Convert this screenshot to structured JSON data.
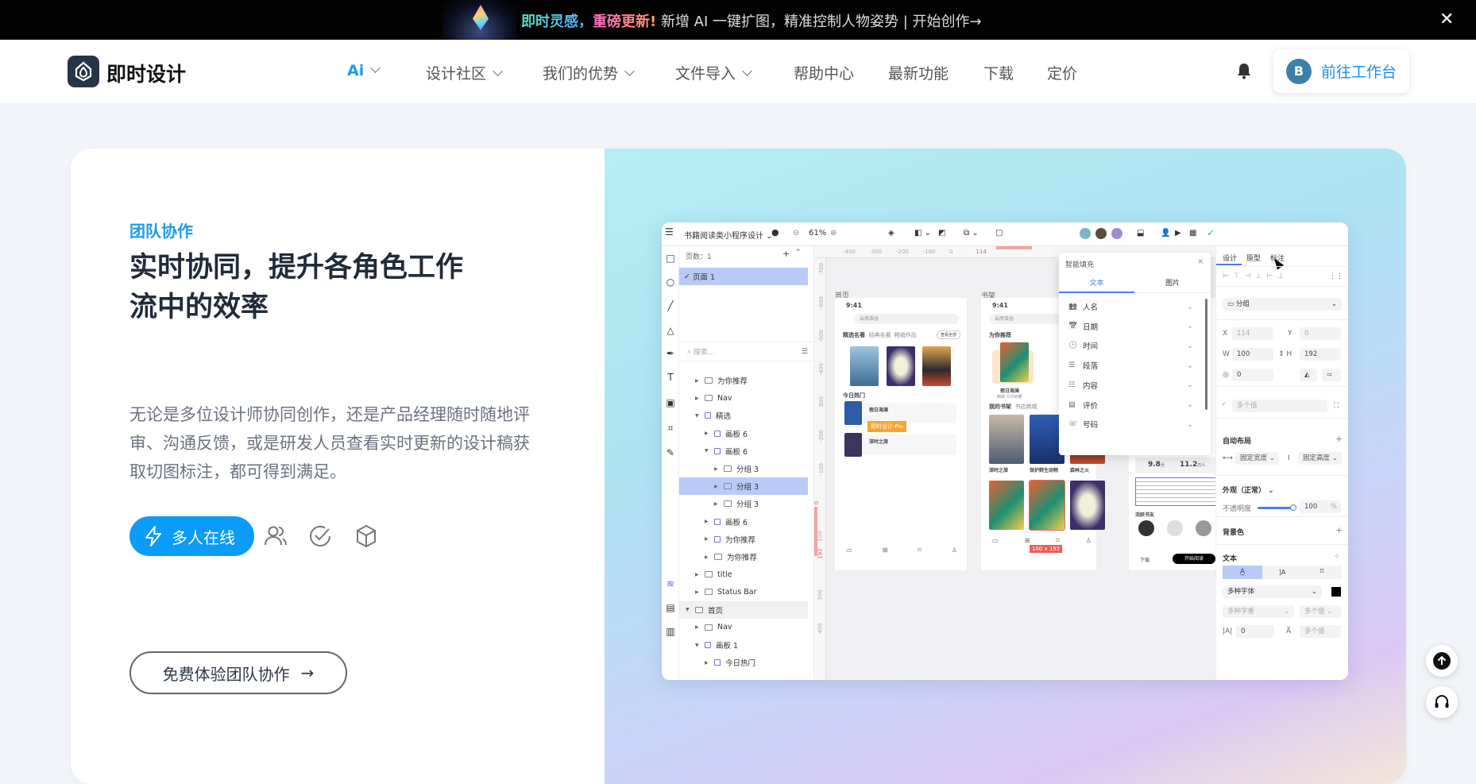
{
  "banner": {
    "highlight1": "即时灵感，",
    "highlight2": "重磅更新!",
    "text": " 新增 AI 一键扩图，精准控制人物姿势  |  开始创作→",
    "close": "✕"
  },
  "nav": {
    "logo": "即时设计",
    "items": [
      {
        "label": "Ai",
        "dropdown": true,
        "active": true
      },
      {
        "label": "设计社区",
        "dropdown": true
      },
      {
        "label": "我们的优势",
        "dropdown": true
      },
      {
        "label": "文件导入",
        "dropdown": true
      },
      {
        "label": "帮助中心"
      },
      {
        "label": "最新功能"
      },
      {
        "label": "下载"
      },
      {
        "label": "定价"
      }
    ],
    "avatar_initial": "B",
    "workbench": "前往工作台"
  },
  "hero": {
    "eyebrow": "团队协作",
    "headline": "实时协同，提升各角色工作流中的效率",
    "description": "无论是多位设计师协同创作，还是产品经理随时随地评审、沟通反馈，或是研发人员查看实时更新的设计稿获取切图标注，都可得到满足。",
    "active_feature": "多人在线",
    "feature_icons": [
      "users-icon",
      "check-circle-icon",
      "cube-icon"
    ],
    "cta": "免费体验团队协作",
    "accent": "#0a9cf6"
  },
  "app": {
    "file_name": "书籍阅读类小程序设计",
    "zoom": "61%",
    "pages_header": "页数：1",
    "page": "页面 1",
    "search_placeholder": "搜索...",
    "layers": [
      {
        "label": "为你推荐",
        "level": 1,
        "type": "folder"
      },
      {
        "label": "Nav",
        "level": 1,
        "type": "folder"
      },
      {
        "label": "精选",
        "level": 1,
        "type": "stack",
        "open": true
      },
      {
        "label": "画板 6",
        "level": 2,
        "type": "frame"
      },
      {
        "label": "画板 6",
        "level": 2,
        "type": "frame",
        "open": true
      },
      {
        "label": "分组 3",
        "level": 3,
        "type": "folder"
      },
      {
        "label": "分组 3",
        "level": 3,
        "type": "folder",
        "selected": true
      },
      {
        "label": "分组 3",
        "level": 3,
        "type": "folder"
      },
      {
        "label": "画板 6",
        "level": 2,
        "type": "frame"
      },
      {
        "label": "为你推荐",
        "level": 2,
        "type": "frame"
      },
      {
        "label": "为你推荐",
        "level": 2,
        "type": "folder"
      },
      {
        "label": "title",
        "level": 1,
        "type": "folder"
      },
      {
        "label": "Status Bar",
        "level": 1,
        "type": "folder"
      },
      {
        "label": "首页",
        "level": 0,
        "type": "board",
        "open": true,
        "highlight": true
      },
      {
        "label": "Nav",
        "level": 1,
        "type": "folder"
      },
      {
        "label": "画板 1",
        "level": 1,
        "type": "stack",
        "open": true
      },
      {
        "label": "今日热门",
        "level": 2,
        "type": "stack"
      }
    ],
    "ruler_top": [
      "-400",
      "-300",
      "-200",
      "-100",
      "0",
      "114"
    ],
    "ruler_left": [
      "-700",
      "-600",
      "-500",
      "-400",
      "-300",
      "-200",
      "-100",
      "0",
      "100",
      "192",
      "300",
      "400"
    ],
    "frames": {
      "home": {
        "label": "首页",
        "time": "9:41",
        "search": "云南虫谷",
        "tabs": [
          "精选名著",
          "经典名著",
          "畅销作品"
        ],
        "more": "查看全部",
        "hot": "今日热门",
        "hot_items": [
          "假日海滩",
          "深时之旅"
        ],
        "cursor_tag": "即时设计-Piu"
      },
      "shelf": {
        "label": "书架",
        "time": "9:41",
        "search": "云南虫谷",
        "recommend": "为你推荐",
        "book": "假日海滩",
        "book_sub": "朝歌·凡尔纳著",
        "my_shelf": "我的书架",
        "store": "书店商城",
        "books": [
          "深时之旅",
          "保护野生动物",
          "森林之火"
        ],
        "size_tag": "100 x 192"
      },
      "detail": {
        "score": "9.8",
        "score_unit": "分",
        "readers": "11.2",
        "readers_unit": "万人",
        "friends": "活跃书友",
        "download": "下载",
        "start": "开始阅读"
      }
    },
    "fill_popup": {
      "title": "智能填充",
      "tabs": [
        "文本",
        "图片"
      ],
      "items": [
        "人名",
        "日期",
        "时间",
        "段落",
        "内容",
        "评价",
        "号码"
      ]
    },
    "props": {
      "tabs": [
        "设计",
        "原型",
        "标注"
      ],
      "group": "分组",
      "x": "114",
      "y": "0",
      "w": "100",
      "h": "192",
      "rotation": "0",
      "radius": "多个值",
      "auto_layout": "自动布局",
      "fixed_width": "固定宽度",
      "fixed_height": "固定高度",
      "appearance": "外观（正常）",
      "opacity_label": "不透明度",
      "opacity": "100",
      "opacity_unit": "%",
      "background": "背景色",
      "text": "文本",
      "font": "多种字体",
      "weight": "多种字重",
      "size": "多个值",
      "letter": "0",
      "line": "多个值"
    }
  }
}
